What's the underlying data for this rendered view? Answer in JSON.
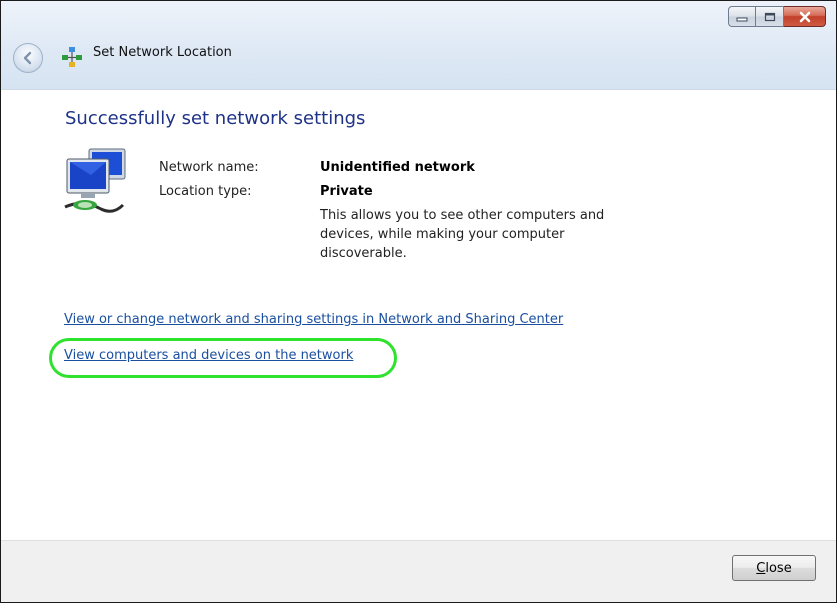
{
  "window": {
    "title": "Set Network Location",
    "icon": "network-center-icon"
  },
  "titlebar": {
    "back_icon": "back-arrow-icon",
    "buttons": {
      "minimize_icon": "minimize-icon",
      "maximize_icon": "maximize-icon",
      "close_icon": "close-icon"
    }
  },
  "main": {
    "heading": "Successfully set network settings",
    "icon": "computer-network-icon",
    "network_name_label": "Network name:",
    "network_name_value": "Unidentified network",
    "location_type_label": "Location type:",
    "location_type_value": "Private",
    "description": "This allows you to see other computers and devices, while making your computer discoverable.",
    "links": [
      {
        "label": "View or change network and sharing settings in Network and Sharing Center"
      },
      {
        "label": "View computers and devices on the network"
      }
    ]
  },
  "footer": {
    "close_label_mnemonic": "C",
    "close_label_rest": "lose"
  },
  "colors": {
    "heading": "#1e3287",
    "link": "#1a4fa0",
    "highlight_ring": "#2ee22e",
    "footer_bg": "#f0f0f0"
  }
}
